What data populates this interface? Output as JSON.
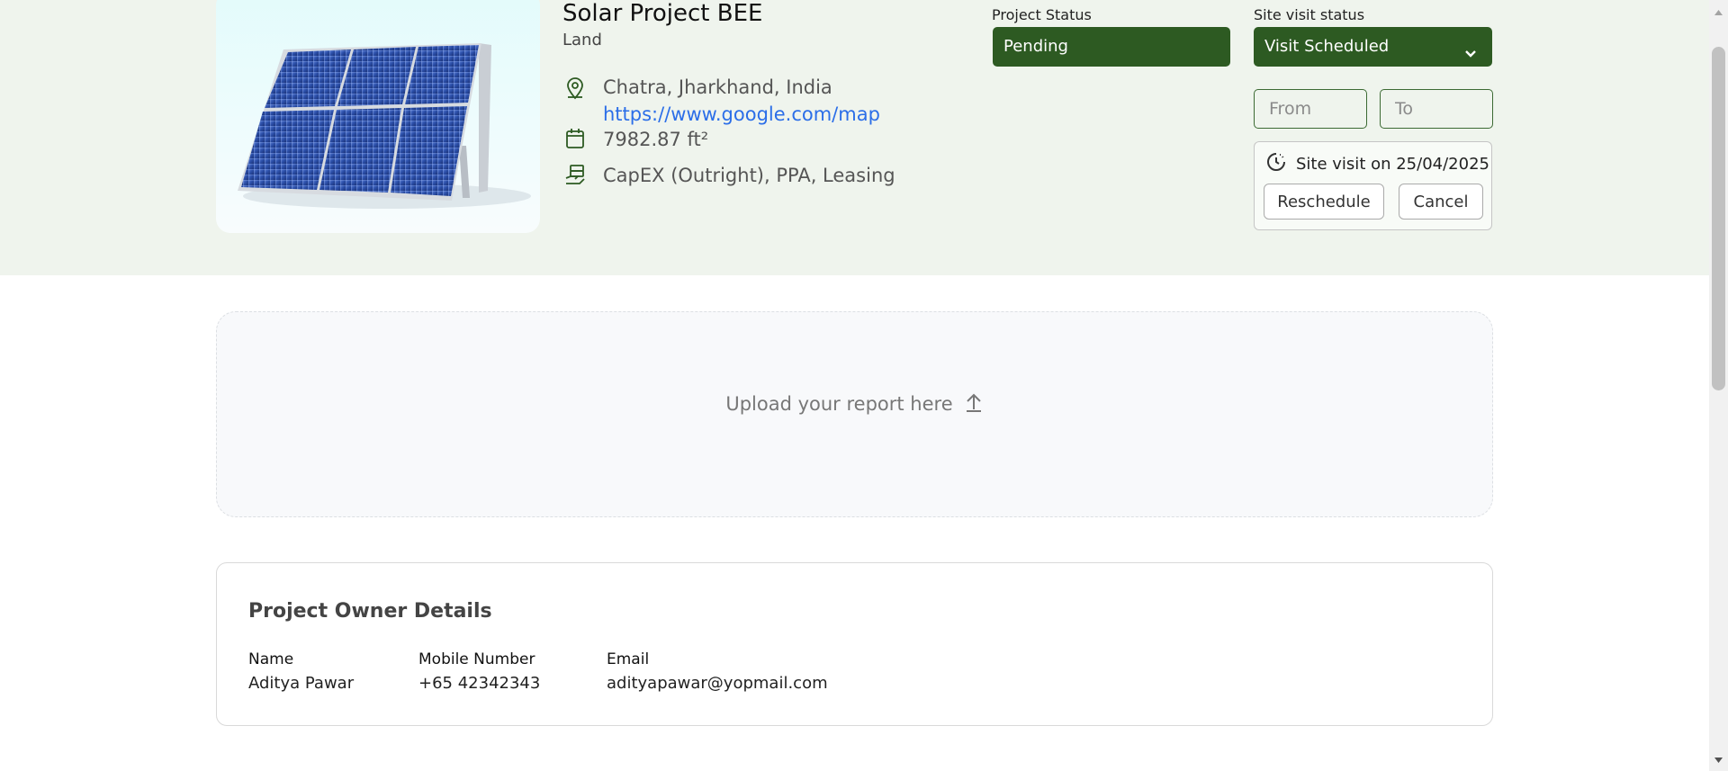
{
  "project": {
    "title": "Solar Project BEE",
    "type": "Land",
    "location": "Chatra, Jharkhand, India",
    "map_link": "https://www.google.com/map",
    "area": "7982.87 ft²",
    "financing": "CapEX (Outright), PPA, Leasing"
  },
  "project_status": {
    "label": "Project Status",
    "value": "Pending"
  },
  "site_visit": {
    "label": "Site visit status",
    "value": "Visit Scheduled",
    "from_placeholder": "From",
    "to_placeholder": "To",
    "scheduled_text": "Site visit on 25/04/2025",
    "reschedule_label": "Reschedule",
    "cancel_label": "Cancel"
  },
  "upload": {
    "text": "Upload your report here"
  },
  "owner": {
    "title": "Project Owner Details",
    "name_label": "Name",
    "name": "Aditya Pawar",
    "mobile_label": "Mobile Number",
    "mobile": "+65 42342343",
    "email_label": "Email",
    "email": "adityapawar@yopmail.com"
  },
  "colors": {
    "header_bg": "#eff4ed",
    "status_green": "#2d5a22",
    "link_blue": "#2b6ee8"
  },
  "icons": [
    "location-pin-icon",
    "area-icon",
    "finance-icon",
    "chevron-down-icon",
    "clock-icon",
    "upload-arrow-icon"
  ]
}
